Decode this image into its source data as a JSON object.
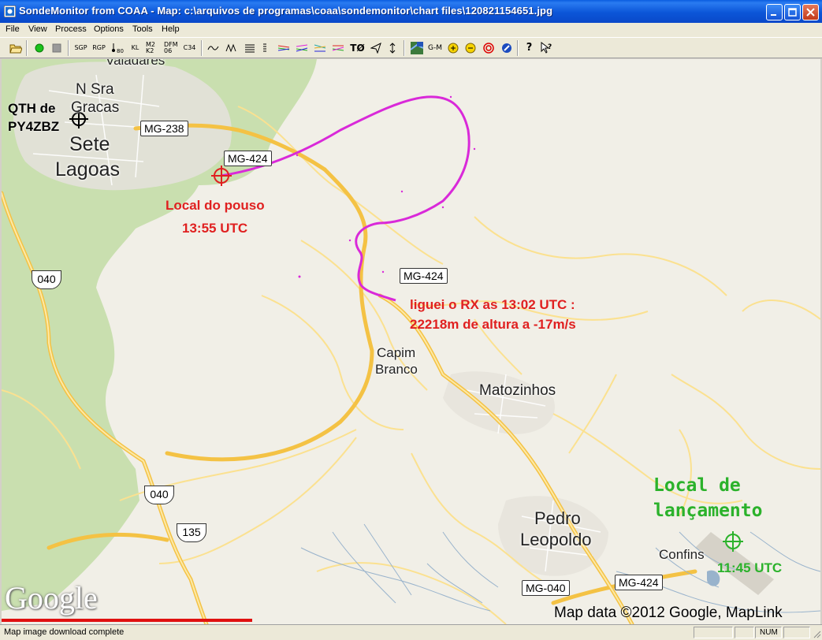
{
  "window": {
    "title": "SondeMonitor from COAA - Map: c:\\arquivos de programas\\coaa\\sondemonitor\\chart files\\120821154651.jpg"
  },
  "menu": [
    "File",
    "View",
    "Process",
    "Options",
    "Tools",
    "Help"
  ],
  "toolbar": {
    "sgp": "SGP",
    "rgp": "RGP",
    "kl": "KL",
    "m2k2": "M2 K2",
    "dfm06": "DFM 06",
    "c34": "C34",
    "t0": "TØ",
    "gm": "G-M"
  },
  "map": {
    "towns": {
      "valadares": "Valadares",
      "nsra": "N Sra",
      "gracas": "Gracas",
      "sete": "Sete",
      "lagoas": "Lagoas",
      "capim": "Capim",
      "branco": "Branco",
      "matozinhos": "Matozinhos",
      "pedro": "Pedro",
      "leopoldo": "Leopoldo",
      "confins": "Confins"
    },
    "roads": {
      "mg238": "MG-238",
      "mg424a": "MG-424",
      "mg424b": "MG-424",
      "mg424c": "MG-424",
      "mg040": "MG-040",
      "s040a": "040",
      "s040b": "040",
      "s135": "135"
    },
    "annotations": {
      "qth1": "QTH de",
      "qth2": "PY4ZBZ",
      "landing1": "Local do pouso",
      "landing2": "13:55 UTC",
      "rx1": "liguei o RX as 13:02 UTC :",
      "rx2": "22218m de altura a -17m/s",
      "launch1": "Local de",
      "launch2": "lançamento",
      "launch3": "11:45 UTC"
    },
    "logo": "Google",
    "copyright": "Map data ©2012 Google, MapLink"
  },
  "status": {
    "text": "Map image download complete",
    "num": "NUM"
  },
  "colors": {
    "track": "#d929d9",
    "title_bar": "#0a56d8",
    "annotation_red": "#e02020",
    "annotation_green": "#2bb22b"
  }
}
